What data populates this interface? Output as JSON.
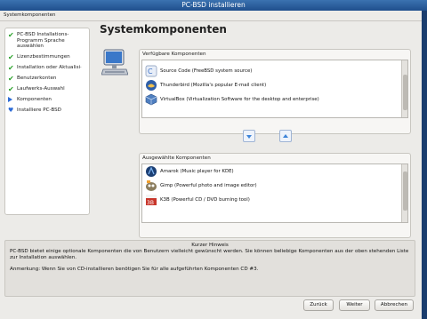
{
  "window": {
    "title": "PC-BSD installieren"
  },
  "menubar": {
    "label": "Systemkomponenten"
  },
  "sidebar": {
    "items": [
      {
        "label": "PC-BSD Installations-Programm Sprache auswählen",
        "state": "done"
      },
      {
        "label": "Lizenzbestimmungen",
        "state": "done"
      },
      {
        "label": "Installation oder Aktualisi·",
        "state": "done"
      },
      {
        "label": "Benutzerkonten",
        "state": "done"
      },
      {
        "label": "Laufwerks-Auswahl",
        "state": "done"
      },
      {
        "label": "Komponenten",
        "state": "current"
      },
      {
        "label": "Installiere PC-BSD",
        "state": "pending"
      }
    ]
  },
  "page": {
    "title": "Systemkomponenten"
  },
  "available": {
    "label": "Verfügbare Komponenten",
    "items": [
      {
        "label": "",
        "icon": "partial-icon"
      },
      {
        "label": "Source Code (FreeBSD system source)",
        "icon": "source-code-icon"
      },
      {
        "label": "Thunderbird (Mozilla's popular E-mail client)",
        "icon": "thunderbird-icon"
      },
      {
        "label": "VirtualBox (Virtualization Software for the desktop and enterprise)",
        "icon": "virtualbox-icon"
      }
    ]
  },
  "selected": {
    "label": "Ausgewählte Komponenten",
    "items": [
      {
        "label": "Amarok (Music player for KDE)",
        "icon": "amarok-icon"
      },
      {
        "label": "Gimp (Powerful photo and image editor)",
        "icon": "gimp-icon"
      },
      {
        "label": "K3B (Powerful CD / DVD burning tool)",
        "icon": "k3b-icon"
      },
      {
        "label": "",
        "icon": "partial-icon"
      }
    ]
  },
  "hint": {
    "title": "Kurzer Hinweis",
    "text": "PC-BSD bietet einige optionale Komponenten die von Benutzern vielleicht gewünscht werden. Sie können beliebige Komponenten aus der oben stehenden Liste zur Installation auswählen.",
    "note": "Anmerkung: Wenn Sie von CD-installieren benötigen Sie für alle aufgeführten Komponenten CD #3."
  },
  "buttons": {
    "back": "Zurück",
    "next": "Weiter",
    "cancel": "Abbrechen"
  },
  "colors": {
    "titlebar": "#2a5e9e",
    "check": "#2aa12a",
    "accent": "#2d6bd6"
  }
}
